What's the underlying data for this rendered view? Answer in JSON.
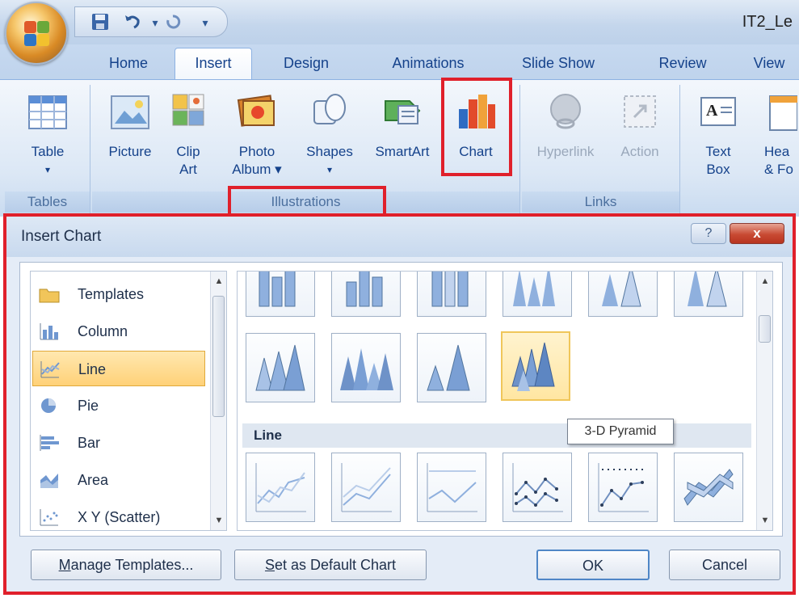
{
  "app": {
    "document_title": "IT2_Le"
  },
  "quick_access": {
    "icons": [
      "save-icon",
      "undo-icon",
      "redo-icon",
      "customize-icon"
    ]
  },
  "tabs": [
    {
      "label": "Home"
    },
    {
      "label": "Insert",
      "active": true
    },
    {
      "label": "Design"
    },
    {
      "label": "Animations"
    },
    {
      "label": "Slide Show"
    },
    {
      "label": "Review"
    },
    {
      "label": "View"
    }
  ],
  "ribbon": {
    "tables": {
      "group_label": "Tables",
      "table": {
        "line1": "Table",
        "line2": "▾"
      }
    },
    "illustrations": {
      "group_label": "Illustrations",
      "picture": {
        "line1": "Picture",
        "line2": ""
      },
      "clip_art": {
        "line1": "Clip",
        "line2": "Art"
      },
      "photo_album": {
        "line1": "Photo",
        "line2": "Album ▾"
      },
      "shapes": {
        "line1": "Shapes",
        "line2": "▾"
      },
      "smartart": {
        "line1": "SmartArt",
        "line2": ""
      },
      "chart": {
        "line1": "Chart",
        "line2": ""
      }
    },
    "links": {
      "group_label": "Links",
      "hyperlink": {
        "line1": "Hyperlink"
      },
      "action": {
        "line1": "Action"
      }
    },
    "text": {
      "text_box": {
        "line1": "Text",
        "line2": "Box"
      },
      "header_footer": {
        "line1": "Hea",
        "line2": "& Fo"
      }
    }
  },
  "colors": {
    "highlight": "#e0202b",
    "selected_item": "#ffd178",
    "ribbon_blue": "#15428b"
  },
  "dialog": {
    "title": "Insert Chart",
    "help_label": "?",
    "close_label": "x",
    "categories": [
      {
        "label": "Templates",
        "icon": "folder-icon"
      },
      {
        "label": "Column",
        "icon": "column-chart-icon"
      },
      {
        "label": "Line",
        "icon": "line-chart-icon",
        "selected": true
      },
      {
        "label": "Pie",
        "icon": "pie-chart-icon"
      },
      {
        "label": "Bar",
        "icon": "bar-chart-icon"
      },
      {
        "label": "Area",
        "icon": "area-chart-icon"
      },
      {
        "label": "X Y (Scatter)",
        "icon": "scatter-chart-icon"
      }
    ],
    "gallery_section": "Line",
    "tooltip": "3-D Pyramid",
    "selected_thumbnail": "3-D Pyramid",
    "manage_templates": {
      "accel": "M",
      "rest": "anage Templates..."
    },
    "set_default": {
      "accel": "S",
      "rest": "et as Default Chart"
    },
    "ok": "OK",
    "cancel": "Cancel"
  }
}
